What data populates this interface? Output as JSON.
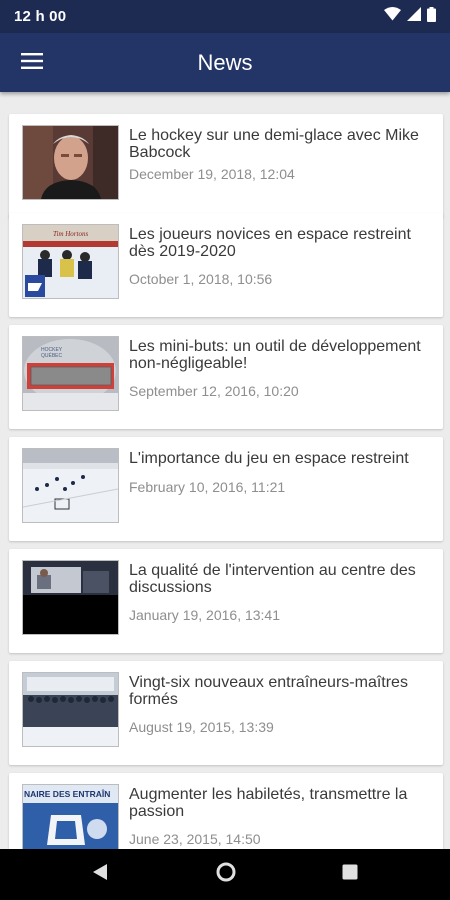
{
  "status": {
    "time": "12 h 00",
    "icons": [
      "wifi-icon",
      "signal-icon",
      "battery-icon"
    ]
  },
  "app_bar": {
    "title": "News",
    "menu_icon": "hamburger-menu-icon"
  },
  "articles": [
    {
      "title": "Le hockey sur une demi-glace avec Mike Babcock",
      "date": "December 19, 2018, 12:04"
    },
    {
      "title": "Les joueurs novices en espace restreint dès 2019-2020",
      "date": "October 1, 2018, 10:56"
    },
    {
      "title": "Les mini-buts: un outil de développement non-négligeable!",
      "date": "September 12, 2016, 10:20"
    },
    {
      "title": "L'importance du jeu en espace restreint",
      "date": "February 10, 2016, 11:21"
    },
    {
      "title": "La qualité de l'intervention au centre des discussions",
      "date": "January 19, 2016, 13:41"
    },
    {
      "title": "Vingt-six nouveaux entraîneurs-maîtres formés",
      "date": "August 19, 2015, 13:39"
    },
    {
      "title": "Augmenter les habiletés, transmettre la passion",
      "date": "June 23, 2015, 14:50"
    }
  ],
  "thumb_text": {
    "hortons": "Tim Hortons",
    "hockey_quebec_line1": "HOCKEY",
    "hockey_quebec_line2": "QUÉBEC",
    "seminar": "NAIRE DES ENTRAÎN"
  },
  "nav": {
    "back_icon": "back-triangle-icon",
    "home_icon": "home-circle-icon",
    "recents_icon": "recents-square-icon"
  },
  "colors": {
    "status_bar": "#1d2b52",
    "app_bar": "#233466",
    "background": "#ececec",
    "card": "#ffffff",
    "title_text": "#3a3a3a",
    "date_text": "#8e8e8e"
  }
}
